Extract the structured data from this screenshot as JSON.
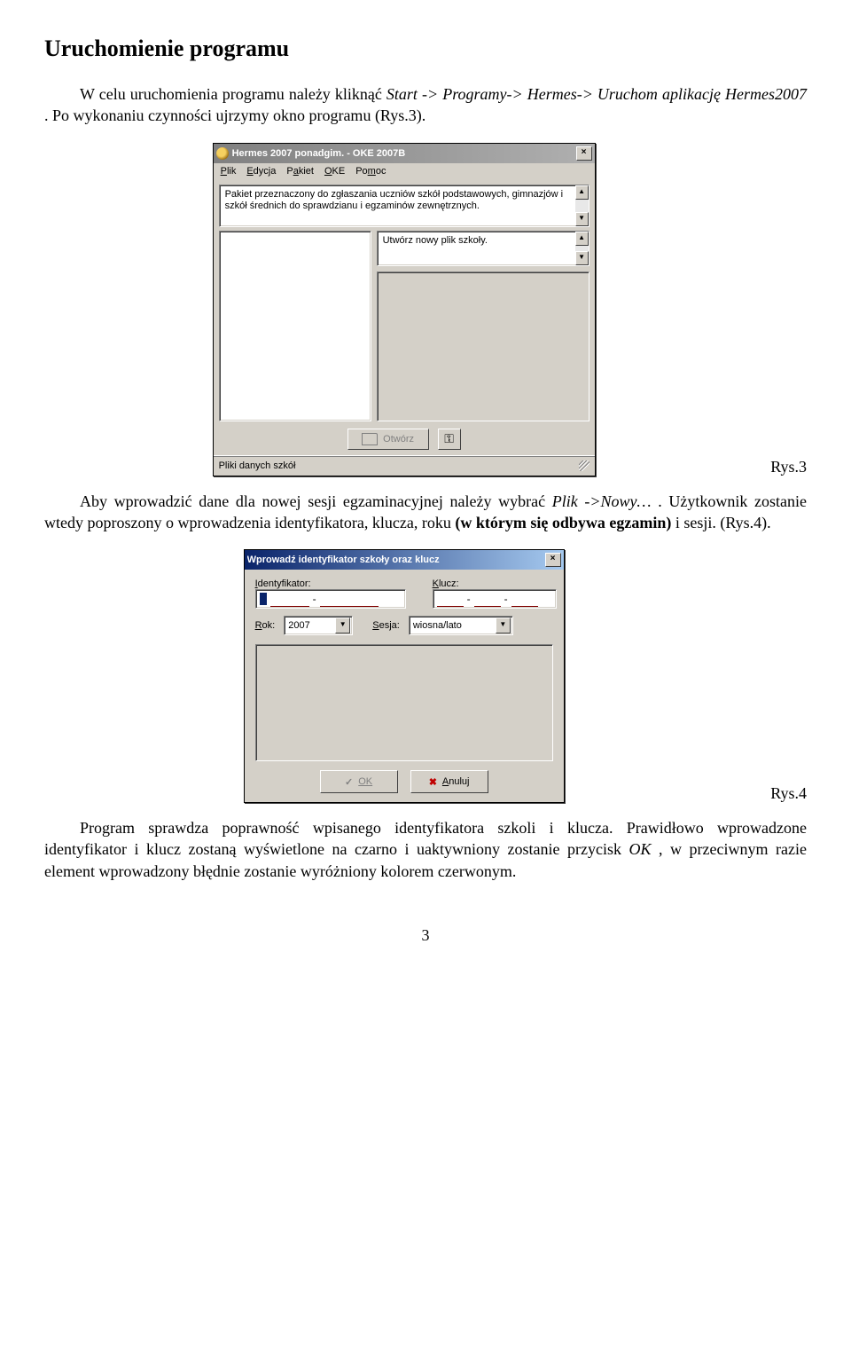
{
  "heading": "Uruchomienie programu",
  "para1_pre": "W celu uruchomienia programu należy kliknąć ",
  "para1_em1": "Start -> Programy-> Hermes-> Uruchom aplikację Hermes2007",
  "para1_post": ". Po wykonaniu czynności ujrzymy okno programu (Rys.3).",
  "caption1": "Rys.3",
  "para2_pre": "Aby wprowadzić dane dla nowej sesji egzaminacyjnej należy wybrać ",
  "para2_em1": "Plik ->Nowy…",
  "para2_mid": ". Użytkownik zostanie wtedy poproszony o wprowadzenia identyfikatora, klucza, roku ",
  "para2_bold": "(w którym się odbywa egzamin)",
  "para2_post": "  i sesji. (Rys.4).",
  "caption2": "Rys.4",
  "para3_pre": "Program sprawdza poprawność wpisanego identyfikatora szkoli i klucza. Prawidłowo wprowadzone identyfikator i klucz zostaną wyświetlone na czarno i uaktywniony zostanie przycisk ",
  "para3_em1": "OK",
  "para3_post": ", w przeciwnym razie element wprowadzony błędnie zostanie wyróżniony kolorem czerwonym.",
  "page_number": "3",
  "win1": {
    "title": "Hermes 2007 ponadgim. - OKE 2007B",
    "menu": {
      "plik": "Plik",
      "edycja": "Edycja",
      "pakiet": "Pakiet",
      "oke": "OKE",
      "pomoc": "Pomoc"
    },
    "desc": "Pakiet przeznaczony do zgłaszania uczniów szkół podstawowych, gimnazjów i szkół średnich do sprawdzianu i egzaminów zewnętrznych.",
    "hint": "Utwórz nowy plik szkoły.",
    "open_btn": "Otwórz",
    "status": "Pliki danych szkół"
  },
  "win2": {
    "title": "Wprowadź identyfikator szkoły oraz klucz",
    "label_ident": "Identyfikator:",
    "label_key": "Klucz:",
    "label_rok": "Rok:",
    "rok_value": "2007",
    "label_sesja": "Sesja:",
    "sesja_value": "wiosna/lato",
    "ok": "OK",
    "anuluj": "Anuluj"
  }
}
